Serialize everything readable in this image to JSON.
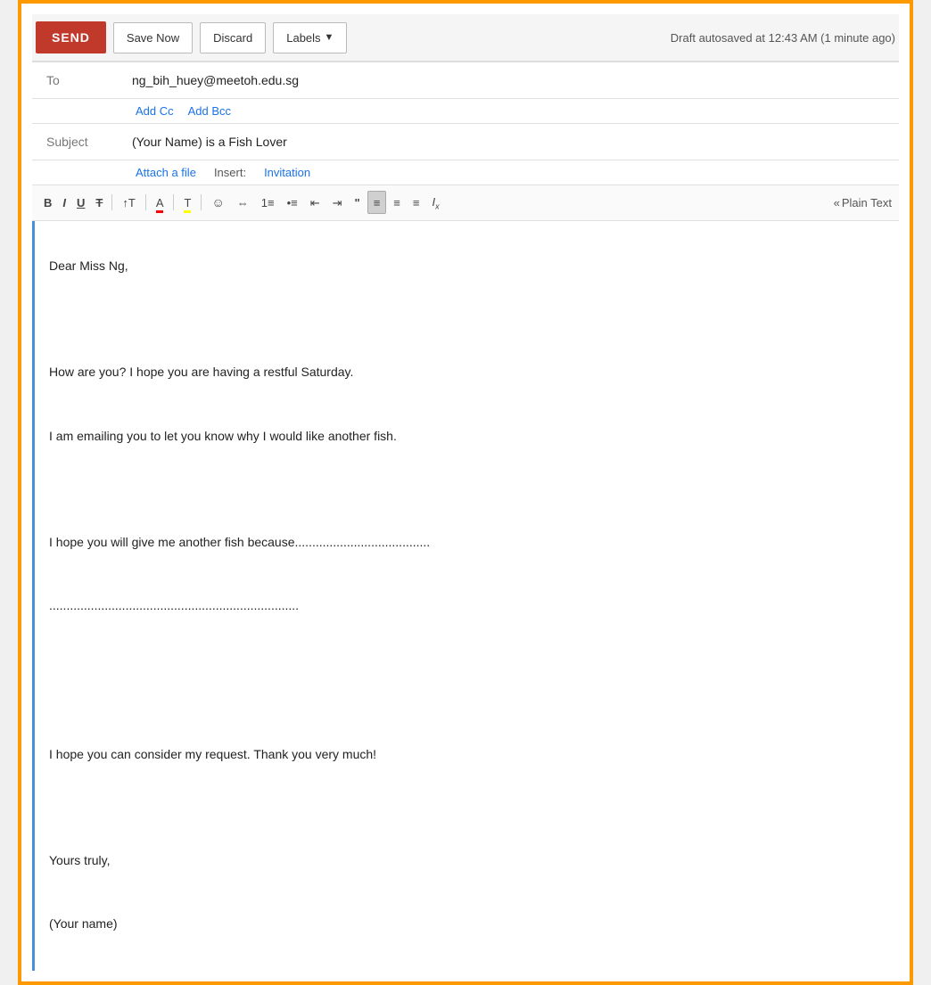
{
  "toolbar": {
    "send_label": "SEND",
    "save_label": "Save Now",
    "discard_label": "Discard",
    "labels_label": "Labels",
    "draft_status": "Draft autosaved at 12:43 AM (1 minute ago)"
  },
  "compose": {
    "to_label": "To",
    "to_value": "ng_bih_huey@meetoh.edu.sg",
    "add_cc": "Add Cc",
    "add_bcc": "Add Bcc",
    "subject_label": "Subject",
    "subject_value": "(Your Name) is a Fish Lover",
    "attach_label": "Attach a file",
    "insert_label": "Insert:",
    "invitation_label": "Invitation"
  },
  "format_toolbar": {
    "bold": "B",
    "italic": "I",
    "underline": "U",
    "strikethrough": "T",
    "font_size_label": "T",
    "font_color_label": "A",
    "text_bg_label": "T",
    "emoji": "☺",
    "link": "∞",
    "ordered_list": "≡",
    "unordered_list": "≔",
    "indent_left": "⇤",
    "indent_right": "⇥",
    "quote": "❝",
    "align_label": "≡",
    "align_center": "≡",
    "align_right": "≡",
    "remove_format": "Ix",
    "plain_text_arrow": "«",
    "plain_text_label": "Plain Text"
  },
  "body": {
    "line1": "Dear Miss Ng,",
    "line2": "",
    "line3": "How are you? I hope you are having a restful Saturday.",
    "line4": "I am emailing you to let you know why I would like another fish.",
    "line5": "",
    "line6": "I hope you will give me another fish because.......................................",
    "line7": "........................................................................",
    "line8": "",
    "line9": "",
    "line10": "I hope you can consider my request. Thank you very much!",
    "line11": "",
    "line12": "Yours truly,",
    "line13": "(Your name)"
  }
}
